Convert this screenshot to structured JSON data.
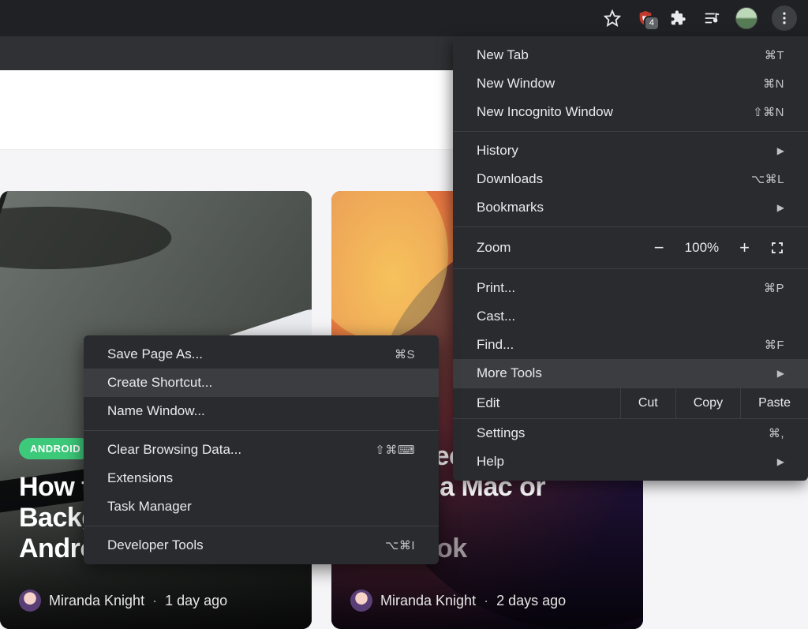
{
  "toolbar": {
    "ext_badge": "4"
  },
  "main_menu": {
    "new_tab": {
      "label": "New Tab",
      "short": "⌘T"
    },
    "new_window": {
      "label": "New Window",
      "short": "⌘N"
    },
    "new_incognito": {
      "label": "New Incognito Window",
      "short": "⇧⌘N"
    },
    "history": {
      "label": "History"
    },
    "downloads": {
      "label": "Downloads",
      "short": "⌥⌘L"
    },
    "bookmarks": {
      "label": "Bookmarks"
    },
    "zoom": {
      "label": "Zoom",
      "value": "100%"
    },
    "print": {
      "label": "Print...",
      "short": "⌘P"
    },
    "cast": {
      "label": "Cast..."
    },
    "find": {
      "label": "Find...",
      "short": "⌘F"
    },
    "more_tools": {
      "label": "More Tools"
    },
    "edit_label": "Edit",
    "edit_cut": "Cut",
    "edit_copy": "Copy",
    "edit_paste": "Paste",
    "settings": {
      "label": "Settings",
      "short": "⌘,"
    },
    "help": {
      "label": "Help"
    }
  },
  "submenu": {
    "save_page": {
      "label": "Save Page As...",
      "short": "⌘S"
    },
    "create_shortcut": {
      "label": "Create Shortcut..."
    },
    "name_window": {
      "label": "Name Window..."
    },
    "clear_browsing": {
      "label": "Clear Browsing Data...",
      "short": "⇧⌘⌨"
    },
    "extensions": {
      "label": "Extensions"
    },
    "task_manager": {
      "label": "Task Manager"
    },
    "developer_tools": {
      "label": "Developer Tools",
      "short": "⌥⌘I"
    }
  },
  "page": {
    "card1": {
      "category": "ANDROID",
      "title": "How to C\nBackgrou\nAndroid",
      "author": "Miranda Knight",
      "time": "1 day ago"
    },
    "card2": {
      "title": "isconnect Incoming\nalls on a Mac or",
      "title_last": "MacBook",
      "author": "Miranda Knight",
      "time": "2 days ago"
    }
  }
}
